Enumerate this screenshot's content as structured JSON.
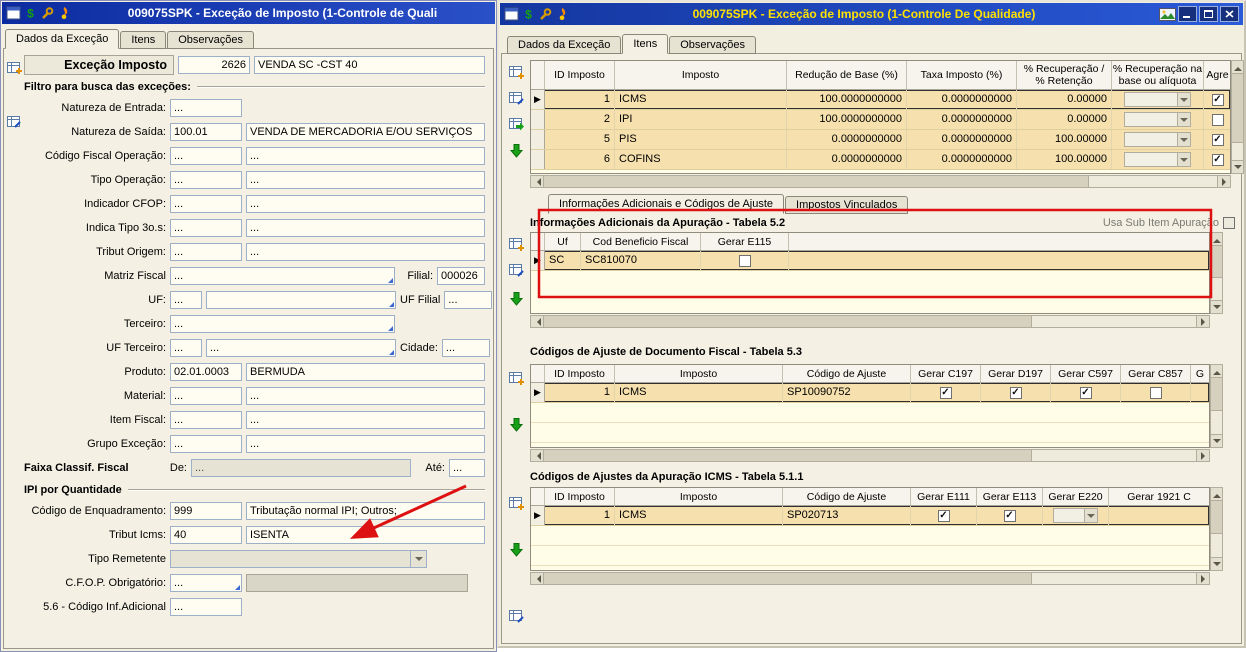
{
  "annotations": {
    "color": "#dd1111"
  },
  "left_window": {
    "title": "009075SPK - Exceção de Imposto (1-Controle de Quali",
    "tabs": {
      "dados": "Dados da Exceção",
      "itens": "Itens",
      "observacoes": "Observações"
    },
    "header": {
      "label": "Exceção Imposto",
      "code": "2626",
      "desc": "VENDA SC -CST 40"
    },
    "section_filtro": "Filtro para busca das exceções:",
    "section_ipi": "IPI por Quantidade",
    "fields": {
      "natureza_entrada": {
        "label": "Natureza de Entrada:",
        "v1": "..."
      },
      "natureza_saida": {
        "label": "Natureza de Saída:",
        "v1": "100.01",
        "v2": "VENDA DE MERCADORIA E/OU SERVIÇOS"
      },
      "codigo_fiscal_operacao": {
        "label": "Código Fiscal Operação:",
        "v1": "...",
        "v2": "..."
      },
      "tipo_operacao": {
        "label": "Tipo Operação:",
        "v1": "...",
        "v2": "..."
      },
      "indicador_cfop": {
        "label": "Indicador CFOP:",
        "v1": "...",
        "v2": "..."
      },
      "indica_tipo_3os": {
        "label": "Indica Tipo 3o.s:",
        "v1": "...",
        "v2": "..."
      },
      "tribut_origem": {
        "label": "Tribut Origem:",
        "v1": "...",
        "v2": "..."
      },
      "matriz_fiscal": {
        "label": "Matriz Fiscal",
        "v1": "...",
        "label2": "Filial:",
        "v2": "000026"
      },
      "uf": {
        "label": "UF:",
        "v1": "...",
        "v2": "",
        "label2": "UF Filial",
        "v3": "..."
      },
      "terceiro": {
        "label": "Terceiro:",
        "v1": "..."
      },
      "uf_terceiro": {
        "label": "UF Terceiro:",
        "v1": "...",
        "v2": "...",
        "label2": "Cidade:",
        "v3": "..."
      },
      "produto": {
        "label": "Produto:",
        "v1": "02.01.0003",
        "v2": "BERMUDA"
      },
      "material": {
        "label": "Material:",
        "v1": "...",
        "v2": "..."
      },
      "item_fiscal": {
        "label": "Item Fiscal:",
        "v1": "...",
        "v2": "..."
      },
      "grupo_excecao": {
        "label": "Grupo Exceção:",
        "v1": "...",
        "v2": "..."
      },
      "faixa": {
        "label": "Faixa Classif. Fiscal",
        "de": "De:",
        "v1": "...",
        "ate": "Até:",
        "v2": "..."
      },
      "codigo_enquadramento": {
        "label": "Código de Enquadramento:",
        "v1": "999",
        "v2": "Tributação normal IPI; Outros;"
      },
      "tribut_icms": {
        "label": "Tribut Icms:",
        "v1": "40",
        "v2": "ISENTA"
      },
      "tipo_remetente": {
        "label": "Tipo Remetente",
        "v1": ""
      },
      "cfop_obrigatorio": {
        "label": "C.F.O.P. Obrigatório:",
        "v1": "..."
      },
      "cod_inf_adicional": {
        "label": "5.6 - Código Inf.Adicional",
        "v1": "..."
      }
    }
  },
  "right_window": {
    "title": "009075SPK - Exceção de Imposto (1-Controle De Qualidade)",
    "tabs": {
      "dados": "Dados da Exceção",
      "itens": "Itens",
      "observacoes": "Observações"
    },
    "marker": "▶",
    "impostos_grid": {
      "col_id": "ID Imposto",
      "col_imposto": "Imposto",
      "col_reducao": "Redução de Base (%)",
      "col_taxa": "Taxa Imposto (%)",
      "col_recup_l1": "% Recuperação /",
      "col_recup_l2": "% Retenção",
      "col_recupbase_l1": "% Recuperação na",
      "col_recupbase_l2": "base ou alíquota",
      "col_agre": "Agre",
      "rows": [
        {
          "id": "1",
          "imposto": "ICMS",
          "reducao": "100.0000000000",
          "taxa": "0.0000000000",
          "recup": "0.00000",
          "agre": "✓"
        },
        {
          "id": "2",
          "imposto": "IPI",
          "reducao": "100.0000000000",
          "taxa": "0.0000000000",
          "recup": "0.00000",
          "agre": ""
        },
        {
          "id": "5",
          "imposto": "PIS",
          "reducao": "0.0000000000",
          "taxa": "0.0000000000",
          "recup": "100.00000",
          "agre": "✓"
        },
        {
          "id": "6",
          "imposto": "COFINS",
          "reducao": "0.0000000000",
          "taxa": "0.0000000000",
          "recup": "100.00000",
          "agre": "✓"
        }
      ]
    },
    "inner_tabs": {
      "adicionais": "Informações Adicionais e Códigos de Ajuste",
      "vinculados": "Impostos Vinculados"
    },
    "tabela_52": {
      "title": "Informações Adicionais da Apuração - Tabela 5.2",
      "usa_sub_label": "Usa Sub Item Apuração",
      "col_uf": "Uf",
      "col_cod": "Cod Beneficio Fiscal",
      "col_e115": "Gerar E115",
      "row": {
        "uf": "SC",
        "cod": "SC810070",
        "e115": ""
      }
    },
    "tabela_53": {
      "title": "Códigos de Ajuste de Documento Fiscal - Tabela 5.3",
      "col_id": "ID Imposto",
      "col_imposto": "Imposto",
      "col_codigo": "Código de Ajuste",
      "col_c197": "Gerar C197",
      "col_d197": "Gerar D197",
      "col_c597": "Gerar C597",
      "col_c857": "Gerar C857",
      "col_g": "G",
      "row": {
        "id": "1",
        "imposto": "ICMS",
        "codigo": "SP10090752",
        "c197": "✓",
        "d197": "✓",
        "c597": "✓",
        "c857": ""
      }
    },
    "tabela_511": {
      "title": "Códigos de Ajustes da Apuração ICMS - Tabela 5.1.1",
      "col_id": "ID Imposto",
      "col_imposto": "Imposto",
      "col_codigo": "Código de Ajuste",
      "col_e111": "Gerar E111",
      "col_e113": "Gerar E113",
      "col_e220": "Gerar E220",
      "col_1921": "Gerar 1921 C",
      "row": {
        "id": "1",
        "imposto": "ICMS",
        "codigo": "SP020713",
        "e111": "✓",
        "e113": "✓"
      }
    }
  }
}
